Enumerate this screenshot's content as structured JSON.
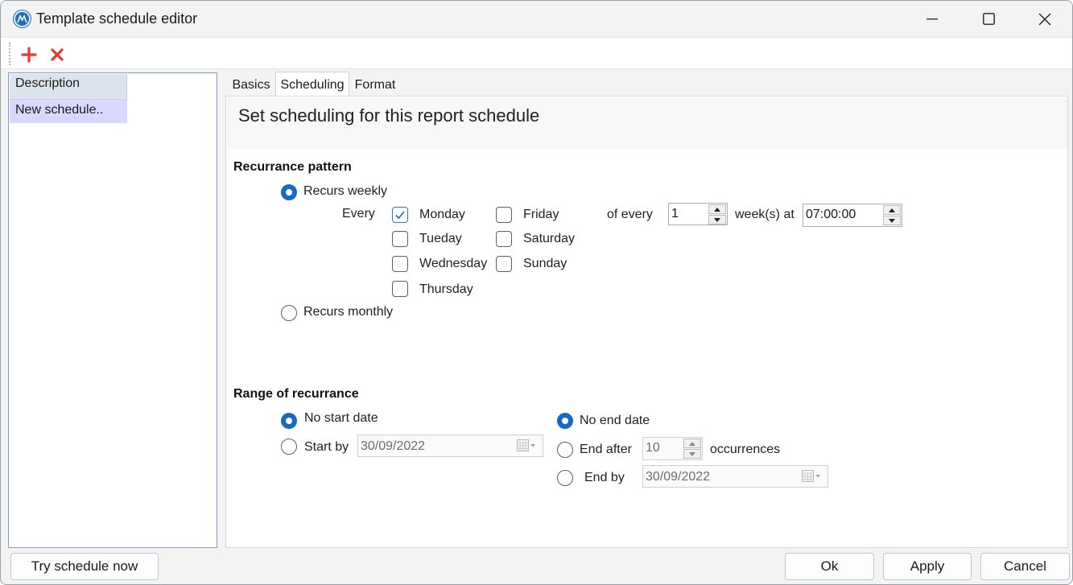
{
  "window": {
    "title": "Template schedule editor"
  },
  "icons": {
    "app": "app-logo-icon",
    "minimize": "minimize-icon",
    "maximize": "maximize-icon",
    "close": "close-icon",
    "add": "plus-icon",
    "delete": "delete-x-icon",
    "calendar": "calendar-dropdown-icon"
  },
  "colors": {
    "accent": "#1769c1",
    "add": "#e8392f",
    "delete": "#e03a2f",
    "selected_row": "#d9d7fb"
  },
  "list": {
    "header": "Description",
    "rows": [
      "New schedule.."
    ]
  },
  "tabs": [
    {
      "label": "Basics",
      "active": false
    },
    {
      "label": "Scheduling",
      "active": true
    },
    {
      "label": "Format",
      "active": false
    }
  ],
  "content": {
    "title": "Set scheduling for this report schedule",
    "pattern": {
      "heading": "Recurrance pattern",
      "weekly_label": "Recurs weekly",
      "weekly_selected": true,
      "every_label": "Every",
      "days": [
        {
          "label": "Monday",
          "checked": true
        },
        {
          "label": "Tueday",
          "checked": false
        },
        {
          "label": "Wednesday",
          "checked": false
        },
        {
          "label": "Thursday",
          "checked": false
        },
        {
          "label": "Friday",
          "checked": false
        },
        {
          "label": "Saturday",
          "checked": false
        },
        {
          "label": "Sunday",
          "checked": false
        }
      ],
      "of_every_label": "of every",
      "weeks_value": "1",
      "weeks_at_label": "week(s) at",
      "time_value": "07:00:00",
      "monthly_label": "Recurs monthly",
      "monthly_selected": false
    },
    "range": {
      "heading": "Range of recurrance",
      "no_start_label": "No start date",
      "no_start_selected": true,
      "start_by_label": "Start by",
      "start_by_value": "30/09/2022",
      "no_end_label": "No end date",
      "no_end_selected": true,
      "end_after_label": "End after",
      "end_after_value": "10",
      "occurrences_label": "occurrences",
      "end_by_label": "End by",
      "end_by_value": "30/09/2022"
    }
  },
  "buttons": {
    "try": "Try schedule now",
    "ok": "Ok",
    "apply": "Apply",
    "cancel": "Cancel"
  }
}
